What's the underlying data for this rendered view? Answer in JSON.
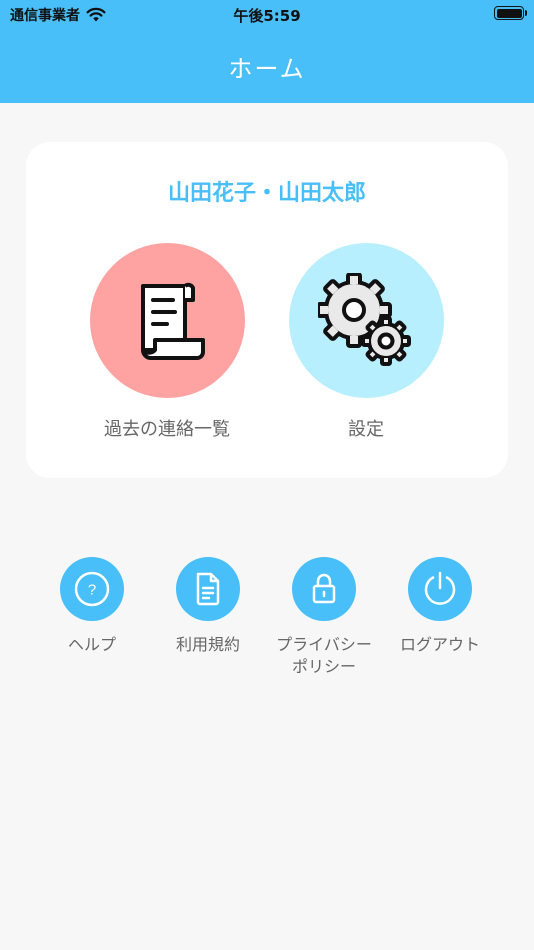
{
  "status_bar": {
    "carrier": "通信事業者",
    "time": "午後5:59"
  },
  "header": {
    "title": "ホーム"
  },
  "card": {
    "family_name": "山田花子・山田太郎",
    "history_label": "過去の連絡一覧",
    "settings_label": "設定"
  },
  "footer_menu": {
    "help": "ヘルプ",
    "terms": "利用規約",
    "privacy": "プライバシー\nポリシー",
    "logout": "ログアウト"
  },
  "colors": {
    "accent": "#48bff9",
    "history_circle": "#ffa2a2",
    "settings_circle": "#b8efff"
  }
}
